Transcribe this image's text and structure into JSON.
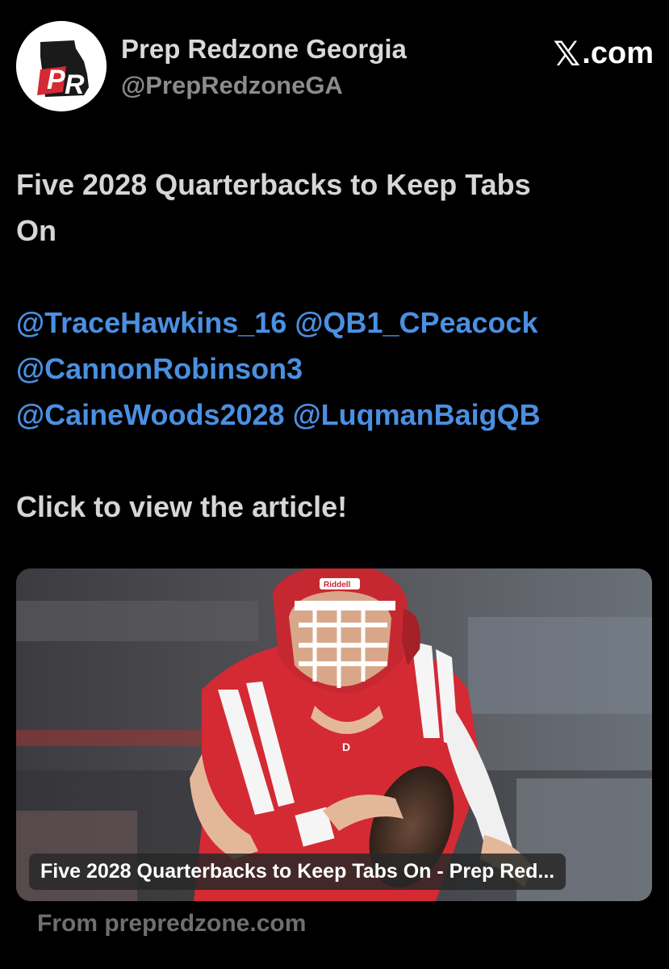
{
  "account": {
    "name": "Prep Redzone Georgia",
    "handle": "@PrepRedzoneGA",
    "avatar_text": "PR"
  },
  "platform": {
    "x_glyph": "𝕏",
    "label": ".com"
  },
  "tweet": {
    "headline_line1": "Five 2028 Quarterbacks to Keep Tabs",
    "headline_line2": "On",
    "mentions": [
      "@TraceHawkins_16",
      "@QB1_CPeacock",
      "@CannonRobinson3",
      "@CaineWoods2028",
      "@LuqmanBaigQB"
    ],
    "cta": "Click to view the article!"
  },
  "card": {
    "title": "Five 2028 Quarterbacks to Keep Tabs On - Prep Red...",
    "helmet_brand": "Riddell",
    "source": "From prepredzone.com"
  },
  "colors": {
    "background": "#000000",
    "mention": "#4a90e2",
    "jersey_red": "#d42a34"
  },
  "icons": [
    "avatar-logo",
    "x-logo-icon"
  ]
}
